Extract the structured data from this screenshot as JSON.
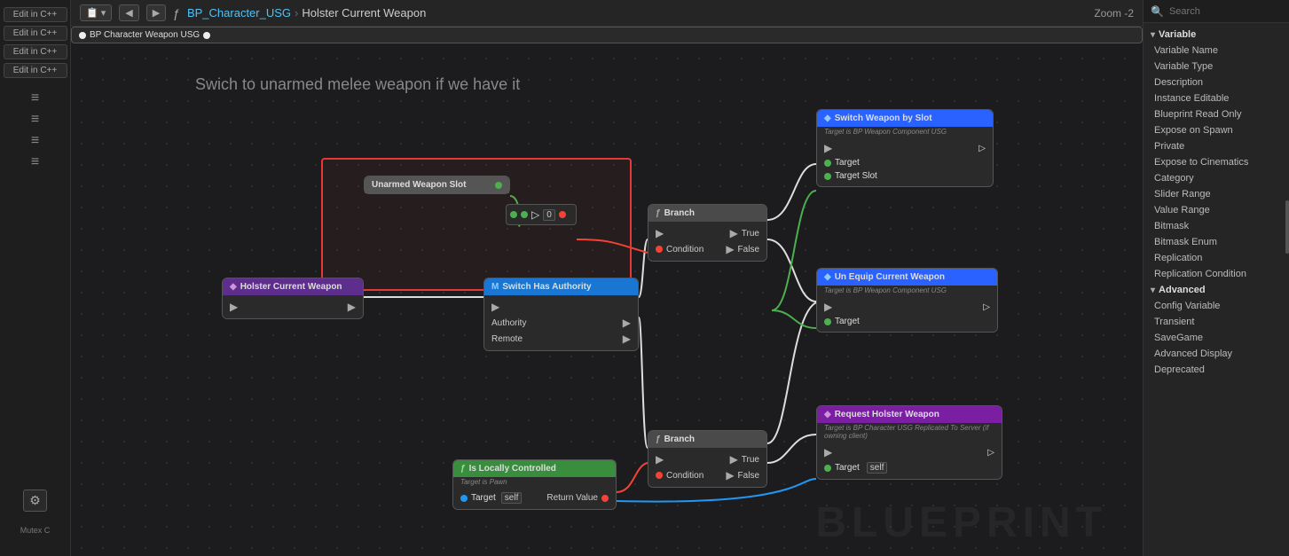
{
  "topbar": {
    "back_btn": "◀",
    "forward_btn": "▶",
    "func_icon": "ƒ",
    "breadcrumb_part1": "BP_Character_USG",
    "breadcrumb_sep": "›",
    "breadcrumb_part2": "Holster Current Weapon",
    "zoom_label": "Zoom -2"
  },
  "sidebar": {
    "edit_cpp_labels": [
      "Edit in C++",
      "Edit in C++",
      "Edit in C++",
      "Edit in C++"
    ],
    "mutex_label": "Mutex C",
    "gear_icon": "⚙",
    "icons": [
      "≡",
      "≡",
      "≡",
      "≡"
    ]
  },
  "canvas": {
    "label": "Swich to unarmed melee weapon if we have it",
    "watermark": "BLUEPRINT",
    "nodes": {
      "holster": {
        "title": "Holster Current Weapon",
        "icon": "◆"
      },
      "switch_auth": {
        "title": "Switch Has Authority",
        "icon": "M",
        "pins": [
          "Authority",
          "Remote"
        ]
      },
      "branch_upper": {
        "title": "Branch",
        "icon": "ƒ",
        "pins": [
          "True",
          "False",
          "Condition"
        ]
      },
      "branch_lower": {
        "title": "Branch",
        "icon": "ƒ",
        "pins": [
          "True",
          "False",
          "Condition"
        ]
      },
      "switch_weapon": {
        "title": "Switch Weapon by Slot",
        "subtitle": "Target is BP Weapon Component USG",
        "icon": "◆",
        "pins": [
          "Target",
          "Target Slot"
        ]
      },
      "unequip": {
        "title": "Un Equip Current Weapon",
        "subtitle": "Target is BP Weapon Component USG",
        "icon": "◆",
        "pin": "Target"
      },
      "request_holster": {
        "title": "Request Holster Weapon",
        "subtitle": "Target is BP Character USG\nReplicated To Server (if owning client)",
        "icon": "◆",
        "pin": "Target",
        "self_label": "self"
      },
      "locally": {
        "title": "Is Locally Controlled",
        "subtitle": "Target is Pawn",
        "icon": "ƒ",
        "pins": [
          "Target",
          "Return Value"
        ],
        "self_label": "self"
      },
      "unarmed": {
        "title": "Unarmed Weapon Slot",
        "pin": ""
      },
      "bp_char": {
        "label": "BP Character Weapon USG"
      }
    }
  },
  "right_panel": {
    "search_placeholder": "Search",
    "section_variable": "Variable",
    "items": [
      "Variable Name",
      "Variable Type",
      "Description",
      "Instance Editable",
      "Blueprint Read Only",
      "Expose on Spawn",
      "Private",
      "Expose to Cinematics",
      "Category",
      "Slider Range",
      "Value Range",
      "Bitmask",
      "Bitmask Enum",
      "Replication",
      "Replication Condition"
    ],
    "section_advanced": "Advanced",
    "advanced_items": [
      "Config Variable",
      "Transient",
      "SaveGame",
      "Advanced Display",
      "Deprecated"
    ]
  }
}
